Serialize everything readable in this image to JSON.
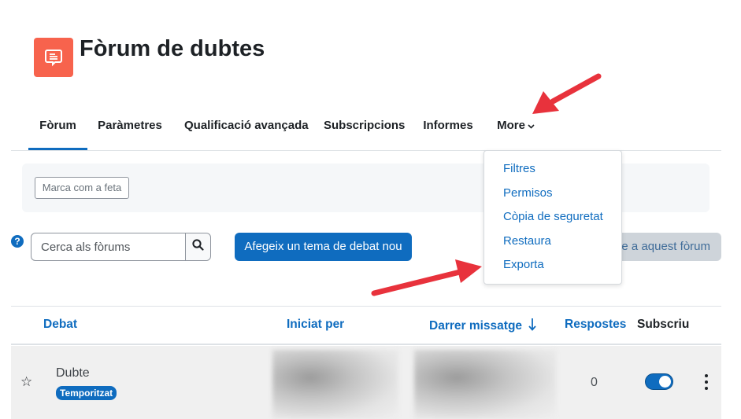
{
  "header": {
    "title": "Fòrum de dubtes",
    "icon": "forum-icon"
  },
  "tabs": [
    {
      "label": "Fòrum",
      "active": true
    },
    {
      "label": "Paràmetres",
      "active": false
    },
    {
      "label": "Qualificació avançada",
      "active": false
    },
    {
      "label": "Subscripcions",
      "active": false
    },
    {
      "label": "Informes",
      "active": false
    },
    {
      "label": "More",
      "active": false
    }
  ],
  "completion": {
    "mark_done_label": "Marca com a feta"
  },
  "toolbar": {
    "search_placeholder": "Cerca als fòrums",
    "add_topic_label": "Afegeix un tema de debat nou",
    "subscribe_label": "e a aquest fòrum"
  },
  "more_menu": {
    "items": [
      "Filtres",
      "Permisos",
      "Còpia de seguretat",
      "Restaura",
      "Exporta"
    ]
  },
  "table": {
    "columns": {
      "debate": "Debat",
      "started_by": "Iniciat per",
      "last_post": "Darrer missatge",
      "replies": "Respostes",
      "subscribe": "Subscriu"
    },
    "rows": [
      {
        "name": "Dubte",
        "badge": "Temporitzat",
        "replies": "0",
        "subscribed": true
      }
    ]
  },
  "colors": {
    "accent": "#0f6cbf",
    "forum_icon_bg": "#f7634d",
    "annotation_arrow": "#e8323c"
  }
}
